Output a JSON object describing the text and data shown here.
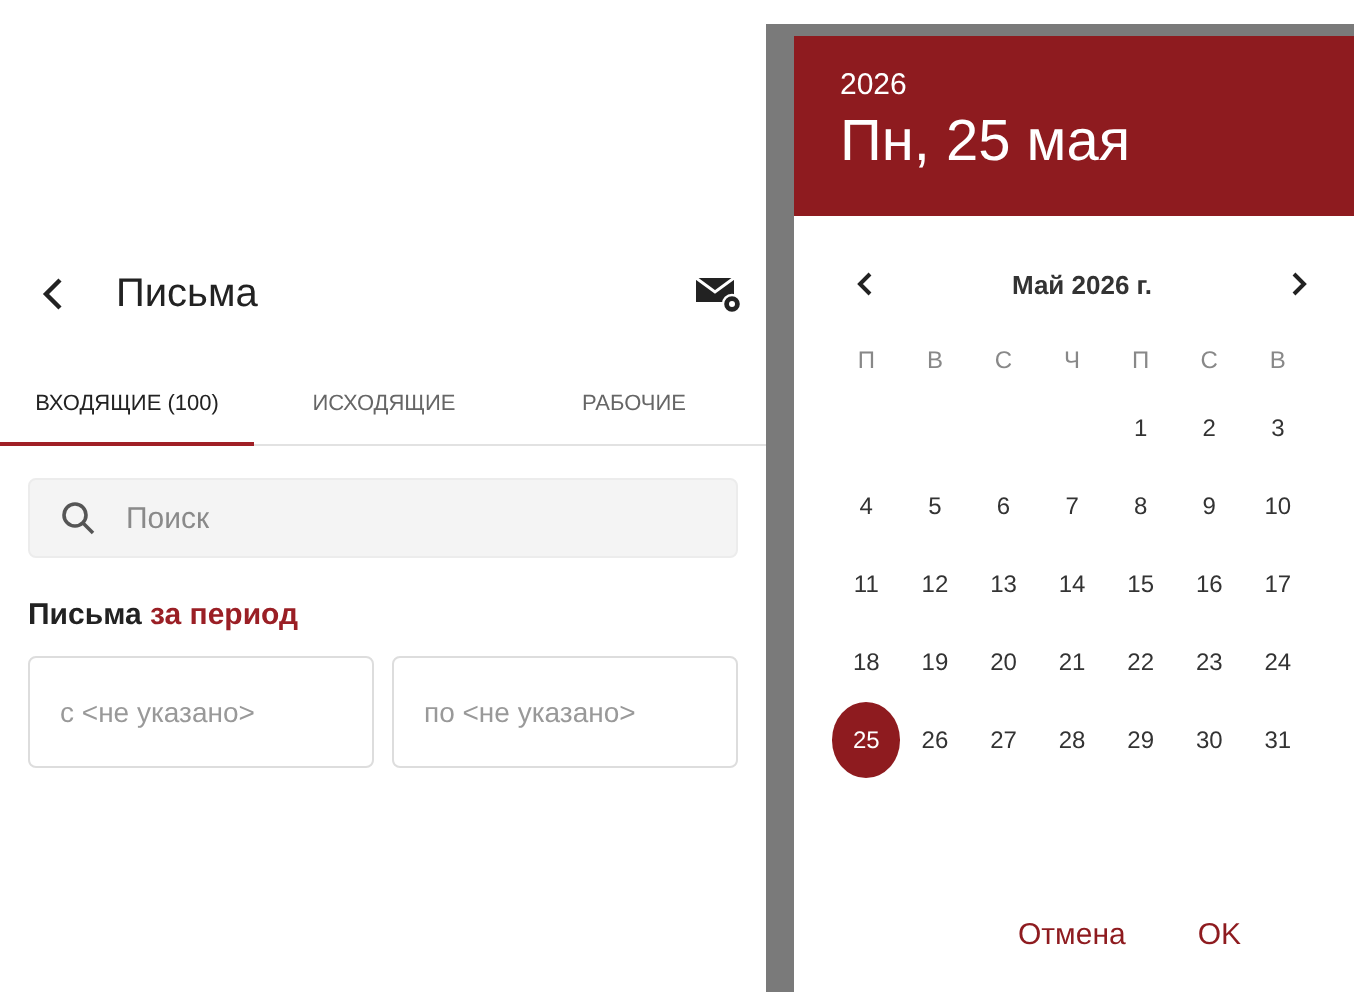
{
  "screen": {
    "title": "Письма",
    "tabs": [
      {
        "label": "ВХОДЯЩИЕ (100)",
        "selected": true
      },
      {
        "label": "ИСХОДЯЩИЕ",
        "selected": false
      },
      {
        "label": "РАБОЧИЕ",
        "selected": false
      }
    ],
    "search": {
      "placeholder": "Поиск"
    },
    "period_label": "Письма **за период**",
    "date_from": {
      "placeholder": "с <не указано>"
    },
    "date_to": {
      "placeholder": "по <не указано>"
    }
  },
  "date_picker": {
    "year": "2026",
    "date": "Пн, 25 мая",
    "month": "Май 2026 г.",
    "weekdays": [
      "П",
      "В",
      "С",
      "Ч",
      "П",
      "С",
      "В"
    ],
    "weeks": [
      [
        {
          "label": "1",
          "selected": false
        },
        {
          "label": "2",
          "selected": false
        },
        {
          "label": "3",
          "selected": false
        }
      ],
      [
        {
          "label": "4",
          "selected": false
        },
        {
          "label": "5",
          "selected": false
        },
        {
          "label": "6",
          "selected": false
        },
        {
          "label": "7",
          "selected": false
        },
        {
          "label": "8",
          "selected": false
        },
        {
          "label": "9",
          "selected": false
        },
        {
          "label": "10",
          "selected": false
        }
      ],
      [
        {
          "label": "11",
          "selected": false
        },
        {
          "label": "12",
          "selected": false
        },
        {
          "label": "13",
          "selected": false
        },
        {
          "label": "14",
          "selected": false
        },
        {
          "label": "15",
          "selected": false
        },
        {
          "label": "16",
          "selected": false
        },
        {
          "label": "17",
          "selected": false
        }
      ],
      [
        {
          "label": "18",
          "selected": false
        },
        {
          "label": "19",
          "selected": false
        },
        {
          "label": "20",
          "selected": false
        },
        {
          "label": "21",
          "selected": false
        },
        {
          "label": "22",
          "selected": false
        },
        {
          "label": "23",
          "selected": false
        },
        {
          "label": "24",
          "selected": false
        }
      ],
      [
        {
          "label": "25",
          "selected": true
        },
        {
          "label": "26",
          "selected": false
        },
        {
          "label": "27",
          "selected": false
        },
        {
          "label": "28",
          "selected": false
        },
        {
          "label": "29",
          "selected": false
        },
        {
          "label": "30",
          "selected": false
        },
        {
          "label": "31",
          "selected": false
        }
      ]
    ],
    "buttons": [
      "Отмена",
      "OK"
    ]
  }
}
